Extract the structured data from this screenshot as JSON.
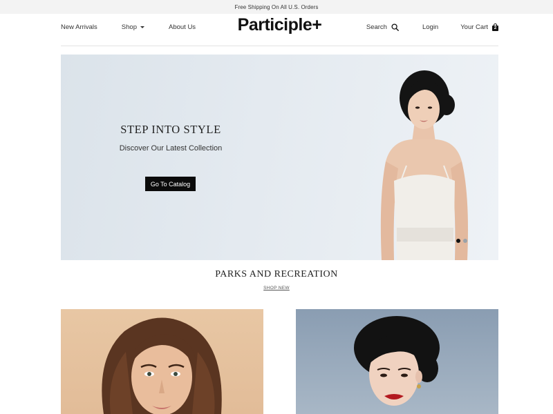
{
  "announcement": {
    "text": "Free Shipping On All U.S. Orders"
  },
  "header": {
    "logo": "Participle+",
    "nav_left": [
      {
        "label": "New Arrivals"
      },
      {
        "label": "Shop",
        "has_dropdown": true
      },
      {
        "label": "About Us"
      }
    ],
    "nav_right": {
      "search_label": "Search",
      "login_label": "Login",
      "cart_label": "Your Cart",
      "cart_count": "2"
    }
  },
  "hero": {
    "title": "STEP INTO STYLE",
    "subtitle": "Discover Our Latest Collection",
    "cta_label": "Go To Catalog",
    "slides_total": 2,
    "active_slide": 1
  },
  "featured_section": {
    "title": "PARKS AND RECREATION",
    "link_label": "SHOP NEW"
  },
  "products": [
    {
      "image": "portrait-woman-wavy-brown-hair"
    },
    {
      "image": "portrait-woman-dark-updo"
    }
  ],
  "colors": {
    "accent": "#0b0b0b",
    "announcement_bg": "#f3f3f3",
    "hero_bg": "#e4eaf0"
  },
  "icons": [
    "search-icon",
    "cart-icon",
    "chevron-down-icon"
  ]
}
